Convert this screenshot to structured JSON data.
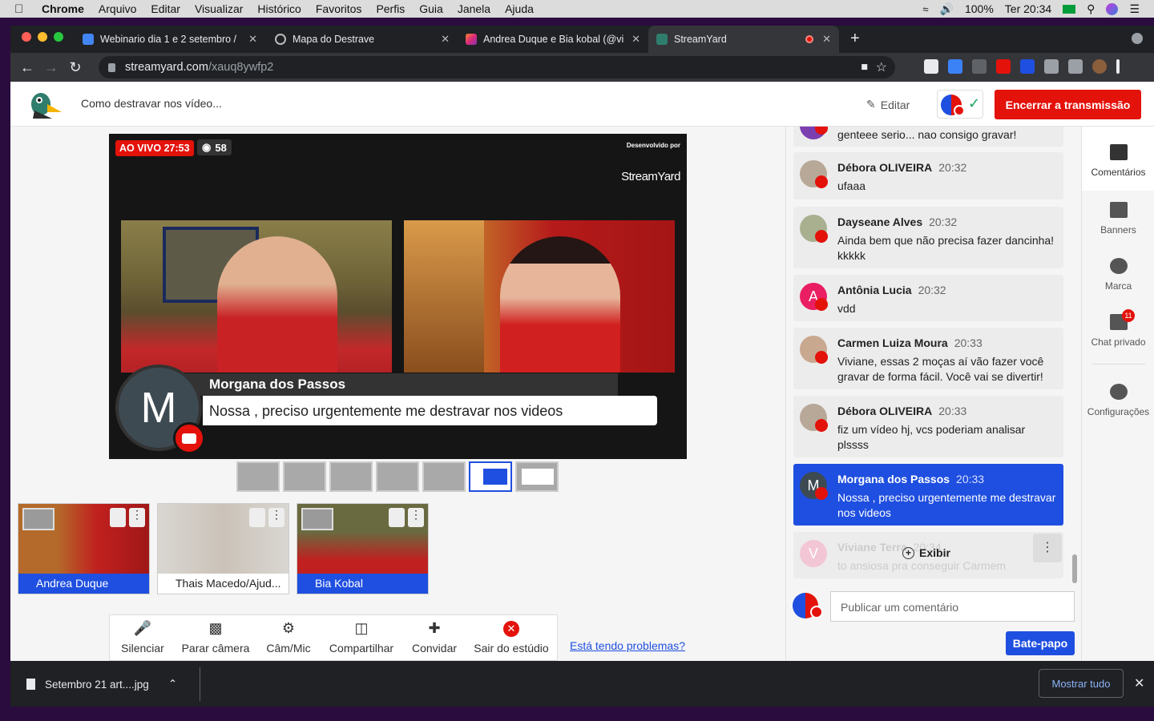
{
  "mac_menubar": {
    "app": "Chrome",
    "items": [
      "Arquivo",
      "Editar",
      "Visualizar",
      "Histórico",
      "Favoritos",
      "Perfis",
      "Guia",
      "Janela",
      "Ajuda"
    ],
    "battery": "100%",
    "clock": "Ter 20:34"
  },
  "browser": {
    "tabs": [
      {
        "title": "Webinario dia 1 e 2 setembro /",
        "close": "✕"
      },
      {
        "title": "Mapa do Destrave",
        "close": "✕"
      },
      {
        "title": "Andrea Duque e Bia kobal (@vi",
        "close": "✕"
      },
      {
        "title": "StreamYard",
        "close": "✕"
      }
    ],
    "new_tab": "+",
    "url_host": "streamyard.com",
    "url_path": "/xauq8ywfp2"
  },
  "app_header": {
    "broadcast_title": "Como destravar nos vídeo...",
    "edit_label": "Editar",
    "end_button": "Encerrar a transmissão"
  },
  "stage": {
    "live_label": "AO VIVO 27:53",
    "viewers": "58",
    "powered_by": "Desenvolvido por",
    "brand": "StreamYard",
    "banner_name": "Morgana dos Passos",
    "banner_message": "Nossa , preciso urgentemente me destravar nos videos",
    "avatar_letter": "M"
  },
  "participants": [
    {
      "name": "Andrea Duque",
      "on_stage": true
    },
    {
      "name": "Thais Macedo/Ajud...",
      "on_stage": false
    },
    {
      "name": "Bia Kobal",
      "on_stage": true
    }
  ],
  "toolbar": {
    "mute": "Silenciar",
    "stop_cam": "Parar câmera",
    "cam_mic": "Câm/Mic",
    "share": "Compartilhar",
    "invite": "Convidar",
    "leave": "Sair do estúdio",
    "problems_link": "Está tendo problemas?"
  },
  "chat": {
    "messages": [
      {
        "author": "",
        "time": "",
        "text": "genteee serio... nao consigo gravar!"
      },
      {
        "author": "Débora OLIVEIRA",
        "time": "20:32",
        "text": "ufaaa"
      },
      {
        "author": "Dayseane Alves",
        "time": "20:32",
        "text": "Ainda bem que não precisa fazer dancinha! kkkkk"
      },
      {
        "author": "Antônia Lucia",
        "time": "20:32",
        "text": "vdd",
        "avatar_letter": "A"
      },
      {
        "author": "Carmen Luiza Moura",
        "time": "20:33",
        "text": "Viviane, essas 2 moças aí vão fazer você gravar de forma fácil. Você vai se divertir!"
      },
      {
        "author": "Débora OLIVEIRA",
        "time": "20:33",
        "text": "fiz um vídeo hj, vcs poderiam analisar plssss"
      },
      {
        "author": "Morgana dos Passos",
        "time": "20:33",
        "text": "Nossa , preciso urgentemente me destravar nos videos",
        "avatar_letter": "M"
      },
      {
        "author": "Viviane Terra",
        "time": "20:34",
        "text": "to ansiosa pra conseguir Carmem",
        "avatar_letter": "V"
      }
    ],
    "show_label": "Exibir",
    "comment_placeholder": "Publicar um comentário",
    "chat_button": "Bate-papo"
  },
  "sidenav": {
    "comments": "Comentários",
    "banners": "Banners",
    "brand": "Marca",
    "private_chat": "Chat privado",
    "private_badge": "11",
    "settings": "Configurações"
  },
  "downloads": {
    "file": "Setembro 21  art....jpg",
    "show_all": "Mostrar tudo"
  },
  "colors": {
    "accent": "#1f4fe0",
    "live_red": "#e3120b"
  }
}
